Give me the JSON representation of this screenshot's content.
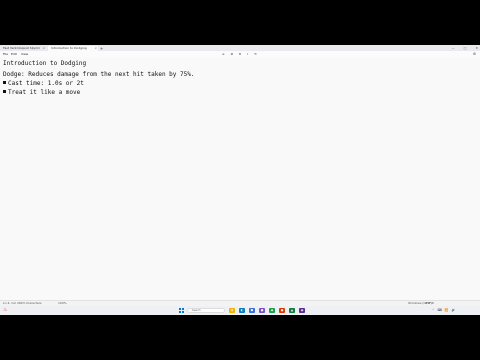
{
  "tabs": [
    {
      "label": "Fast Ventriloquist Skyrim",
      "close": "×"
    },
    {
      "label": "Introduction to Dodging",
      "close": "×"
    }
  ],
  "new_tab_label": "+",
  "window_controls": {
    "minimize": "—",
    "maximize": "□",
    "close": "✕"
  },
  "menu": {
    "file": "File",
    "edit": "Edit",
    "view": "View"
  },
  "toolbar_icons": [
    "≡",
    "≣",
    "B",
    "I",
    "⟲"
  ],
  "settings_icon": "⚙",
  "document": {
    "title": "Introduction to Dodging",
    "line": "Dodge: Reduces damage from the next hit taken by 75%.",
    "bullets": [
      "Cast time: 1.0s or 2t",
      "Treat it like a move"
    ]
  },
  "status": {
    "position": "Ln 4, Col 21",
    "chars": "103 characters",
    "zoom": "100%",
    "line_end": "Windows (CRLF)",
    "encoding": "UTF-8",
    "extra": ""
  },
  "taskbar": {
    "weather_icon": "♨",
    "weather_text": "",
    "search_placeholder": "Search",
    "apps": [
      {
        "name": "file-explorer-icon",
        "glyph": "▮",
        "color": "#f0b400"
      },
      {
        "name": "edge-icon",
        "glyph": "◐",
        "color": "#0a7cbd"
      },
      {
        "name": "store-icon",
        "glyph": "◼",
        "color": "#3a6fd8"
      },
      {
        "name": "app-icon-4",
        "glyph": "●",
        "color": "#7a4fc9"
      },
      {
        "name": "app-icon-5",
        "glyph": "◆",
        "color": "#1e9e4a"
      },
      {
        "name": "app-icon-6",
        "glyph": "●",
        "color": "#d83b01"
      },
      {
        "name": "app-icon-7",
        "glyph": "▲",
        "color": "#107c41"
      },
      {
        "name": "app-icon-8",
        "glyph": "◉",
        "color": "#5c2d91"
      }
    ],
    "tray": [
      "⌃",
      "⌨",
      "📶",
      "🔊"
    ],
    "time": "",
    "date": ""
  }
}
